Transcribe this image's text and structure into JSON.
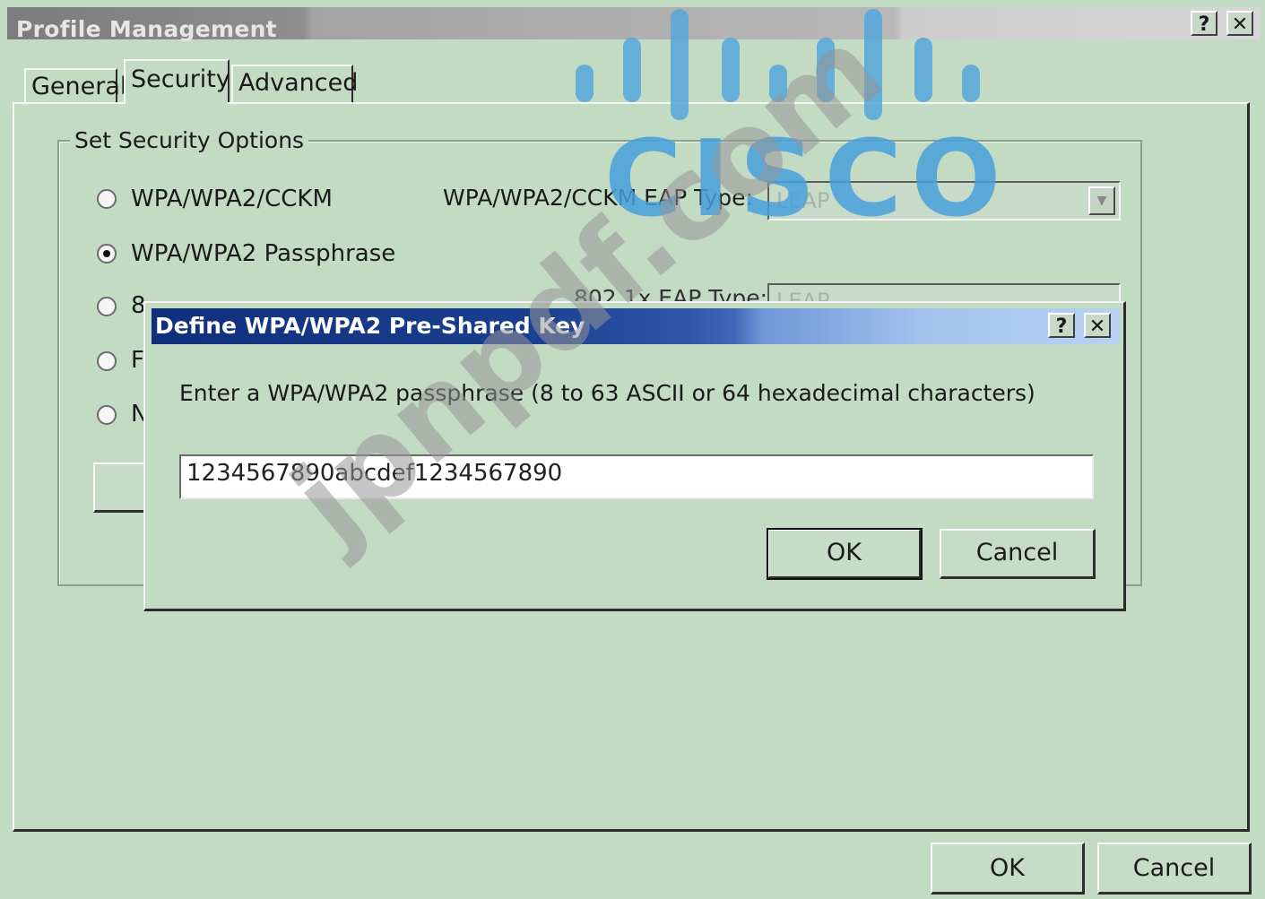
{
  "window": {
    "title": "Profile Management",
    "help_label": "?",
    "close_label": "✕"
  },
  "tabs": [
    {
      "label": "General",
      "active": false
    },
    {
      "label": "Security",
      "active": true
    },
    {
      "label": "Advanced",
      "active": false
    }
  ],
  "security": {
    "group_label": "Set Security Options",
    "options": [
      {
        "label": "WPA/WPA2/CCKM",
        "checked": false
      },
      {
        "label": "WPA/WPA2 Passphrase",
        "checked": true
      },
      {
        "label": "8",
        "checked": false
      },
      {
        "label": "F",
        "checked": false
      },
      {
        "label": "N",
        "checked": false
      }
    ],
    "eap_type_label": "WPA/WPA2/CCKM EAP Type:",
    "eap_type_value": "LEAP",
    "dot1x_label": "802.1x EAP Type:",
    "dot1x_value": "LEAP"
  },
  "dialog": {
    "title": "Define WPA/WPA2 Pre-Shared Key",
    "help_label": "?",
    "close_label": "✕",
    "prompt": "Enter a WPA/WPA2 passphrase (8 to 63 ASCII or 64 hexadecimal characters)",
    "passphrase_value": "1234567890abcdef1234567890",
    "ok_label": "OK",
    "cancel_label": "Cancel"
  },
  "footer": {
    "ok_label": "OK",
    "cancel_label": "Cancel"
  },
  "overlay": {
    "logo_text": "CISCO",
    "watermark_text": "jpnpdf.com"
  },
  "colors": {
    "window_bg": "#c3dac3",
    "dialog_title_start": "#102f7c",
    "dialog_title_end": "#b8d2f4",
    "logo_blue": "#57a7db"
  }
}
